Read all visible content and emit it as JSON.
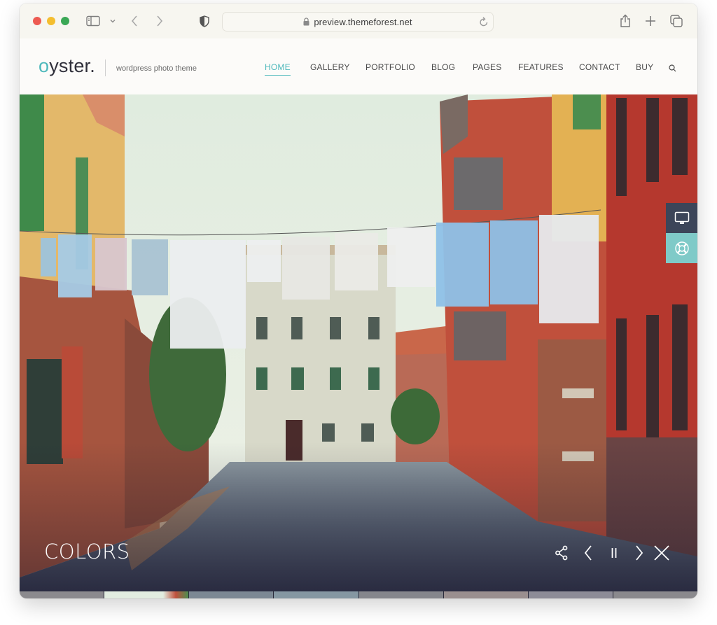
{
  "browser": {
    "url": "preview.themeforest.net",
    "icons": {
      "close": "traffic-light-red",
      "minimize": "traffic-light-yellow",
      "maximize": "traffic-light-green",
      "sidebar": "sidebar-icon",
      "sidebar_menu": "chevron-down-icon",
      "back": "chevron-left-icon",
      "forward": "chevron-right-icon",
      "privacy": "shield-icon",
      "lock": "lock-icon",
      "reload": "reload-icon",
      "share": "share-icon",
      "new_tab": "plus-icon",
      "tabs": "tabs-overview-icon"
    },
    "colors": {
      "red": "#ed5a51",
      "yellow": "#f4be2f",
      "green": "#3aa855"
    }
  },
  "site": {
    "logo": {
      "accent_letter": "o",
      "rest": "yster."
    },
    "tagline": "wordpress photo theme",
    "accent_color": "#4fb9bc",
    "nav": [
      {
        "label": "HOME",
        "active": true
      },
      {
        "label": "GALLERY",
        "active": false
      },
      {
        "label": "PORTFOLIO",
        "active": false
      },
      {
        "label": "BLOG",
        "active": false
      },
      {
        "label": "PAGES",
        "active": false
      },
      {
        "label": "FEATURES",
        "active": false
      },
      {
        "label": "CONTACT",
        "active": false
      },
      {
        "label": "BUY",
        "active": false
      }
    ],
    "search_icon": "search-icon"
  },
  "hero": {
    "title": "COLORS",
    "controls": [
      "share-icon",
      "prev-icon",
      "pause-icon",
      "next-icon",
      "close-icon"
    ],
    "side_buttons": [
      {
        "name": "demo",
        "icon": "monitor-icon",
        "color": "#3c4559"
      },
      {
        "name": "support",
        "icon": "lifebuoy-icon",
        "color": "#7fcac8"
      }
    ],
    "thumbnail_count": 8
  }
}
